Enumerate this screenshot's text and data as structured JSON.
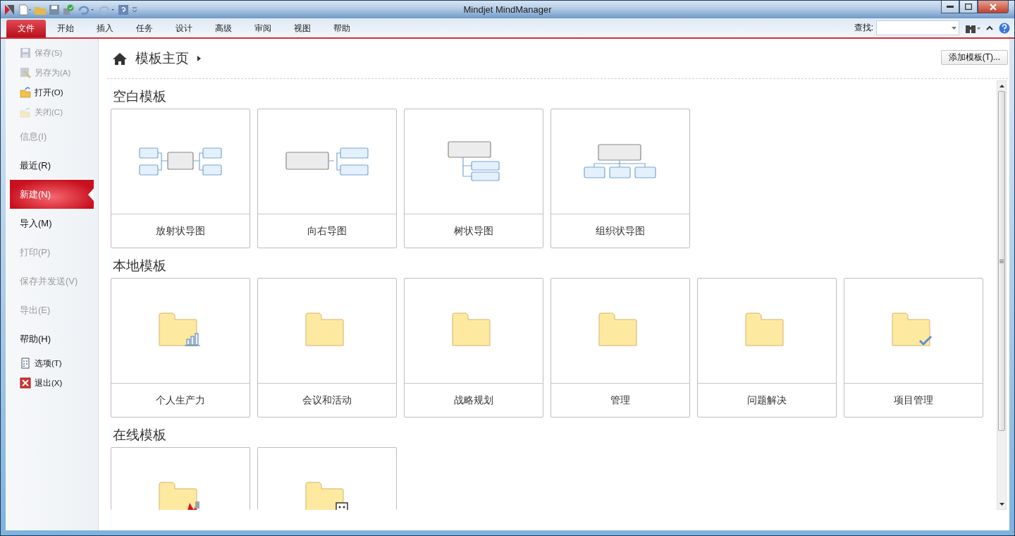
{
  "window": {
    "title": "Mindjet MindManager"
  },
  "ribbon_tabs": [
    {
      "label": "文件",
      "selected": true
    },
    {
      "label": "开始",
      "selected": false
    },
    {
      "label": "插入",
      "selected": false
    },
    {
      "label": "任务",
      "selected": false
    },
    {
      "label": "设计",
      "selected": false
    },
    {
      "label": "高级",
      "selected": false
    },
    {
      "label": "审阅",
      "selected": false
    },
    {
      "label": "视图",
      "selected": false
    },
    {
      "label": "帮助",
      "selected": false
    }
  ],
  "search": {
    "label": "查找:"
  },
  "sidebar": {
    "items": [
      {
        "kind": "command",
        "label": "保存(S)",
        "disabled": true
      },
      {
        "kind": "command",
        "label": "另存为(A)",
        "disabled": true
      },
      {
        "kind": "command",
        "label": "打开(O)",
        "disabled": false
      },
      {
        "kind": "command",
        "label": "关闭(C)",
        "disabled": true
      },
      {
        "kind": "section",
        "label": "信息(I)",
        "disabled": true,
        "selected": false
      },
      {
        "kind": "section",
        "label": "最近(R)",
        "disabled": false,
        "selected": false
      },
      {
        "kind": "section",
        "label": "新建(N)",
        "disabled": false,
        "selected": true
      },
      {
        "kind": "section",
        "label": "导入(M)",
        "disabled": false,
        "selected": false
      },
      {
        "kind": "section",
        "label": "打印(P)",
        "disabled": true,
        "selected": false
      },
      {
        "kind": "section",
        "label": "保存并发送(V)",
        "disabled": true,
        "selected": false
      },
      {
        "kind": "section",
        "label": "导出(E)",
        "disabled": true,
        "selected": false
      },
      {
        "kind": "section",
        "label": "帮助(H)",
        "disabled": false,
        "selected": false
      },
      {
        "kind": "command",
        "label": "选项(T)",
        "disabled": false
      },
      {
        "kind": "command",
        "label": "退出(X)",
        "disabled": false
      }
    ]
  },
  "breadcrumb": {
    "label": "模板主页"
  },
  "add_template_button": "添加模板(T)...",
  "sections": [
    {
      "title": "空白模板",
      "cards": [
        {
          "kind": "radial",
          "label": "放射状导图"
        },
        {
          "kind": "right",
          "label": "向右导图"
        },
        {
          "kind": "tree",
          "label": "树状导图"
        },
        {
          "kind": "org",
          "label": "组织状导图"
        }
      ]
    },
    {
      "title": "本地模板",
      "cards": [
        {
          "kind": "folder-chart",
          "label": "个人生产力"
        },
        {
          "kind": "folder",
          "label": "会议和活动"
        },
        {
          "kind": "folder",
          "label": "战略规划"
        },
        {
          "kind": "folder",
          "label": "管理"
        },
        {
          "kind": "folder",
          "label": "问题解决"
        },
        {
          "kind": "folder-check",
          "label": "项目管理"
        }
      ]
    },
    {
      "title": "在线模板",
      "cards": [
        {
          "kind": "folder-logo"
        },
        {
          "kind": "folder-grid"
        }
      ]
    }
  ]
}
